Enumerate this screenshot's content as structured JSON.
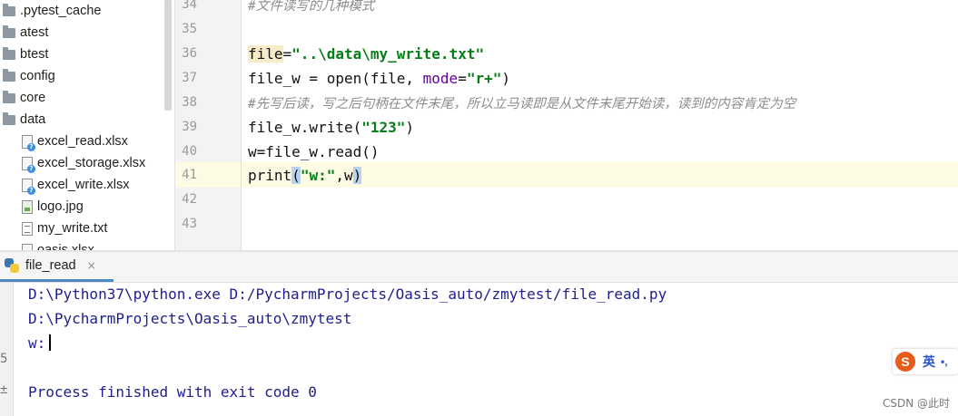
{
  "project_tree": {
    "items": [
      {
        "label": ".pytest_cache",
        "icon": "folder-icon"
      },
      {
        "label": "atest",
        "icon": "folder-icon"
      },
      {
        "label": "btest",
        "icon": "folder-icon"
      },
      {
        "label": "config",
        "icon": "folder-icon"
      },
      {
        "label": "core",
        "icon": "folder-icon"
      },
      {
        "label": "data",
        "icon": "folder-icon"
      },
      {
        "label": "excel_read.xlsx",
        "icon": "unknown-file-icon"
      },
      {
        "label": "excel_storage.xlsx",
        "icon": "unknown-file-icon"
      },
      {
        "label": "excel_write.xlsx",
        "icon": "unknown-file-icon"
      },
      {
        "label": "logo.jpg",
        "icon": "image-file-icon"
      },
      {
        "label": "my_write.txt",
        "icon": "text-file-icon"
      },
      {
        "label": "oasis.xlsx",
        "icon": "unknown-file-icon"
      }
    ]
  },
  "editor": {
    "line_numbers": [
      "34",
      "35",
      "36",
      "37",
      "38",
      "39",
      "40",
      "41",
      "42",
      "43"
    ],
    "current_line": "41",
    "lines": {
      "l34": "#文件读写的几种模式",
      "l36_var": "file",
      "l36_eq": "=",
      "l36_str": "\"..\\data\\my_write.txt\"",
      "l37_a": "file_w = open(file, ",
      "l37_kw": "mode",
      "l37_eq": "=",
      "l37_str": "\"r+\"",
      "l37_end": ")",
      "l38": "#先写后读，写之后句柄在文件末尾，所以立马读即是从文件末尾开始读，读到的内容肯定为空",
      "l39_a": "file_w.write(",
      "l39_str": "\"123\"",
      "l39_end": ")",
      "l40": "w=file_w.read()",
      "l41_a": "print",
      "l41_open": "(",
      "l41_str": "\"w:\"",
      "l41_b": ",w",
      "l41_close": ")"
    }
  },
  "run_panel": {
    "tab_label": "file_read",
    "close_glyph": "×",
    "output": [
      "D:\\Python37\\python.exe D:/PycharmProjects/Oasis_auto/zmytest/file_read.py",
      "D:\\PycharmProjects\\Oasis_auto\\zmytest",
      "w:",
      "",
      "Process finished with exit code 0"
    ],
    "left_strip_glyphs": [
      "5",
      "±"
    ]
  },
  "ime": {
    "logo": "S",
    "lang": "英",
    "punct": "•,"
  },
  "watermark": "CSDN @此时",
  "colors": {
    "accent": "#4a88c7",
    "string": "#067d17",
    "keyword_arg": "#660099",
    "console_text": "#1e1e8e"
  }
}
